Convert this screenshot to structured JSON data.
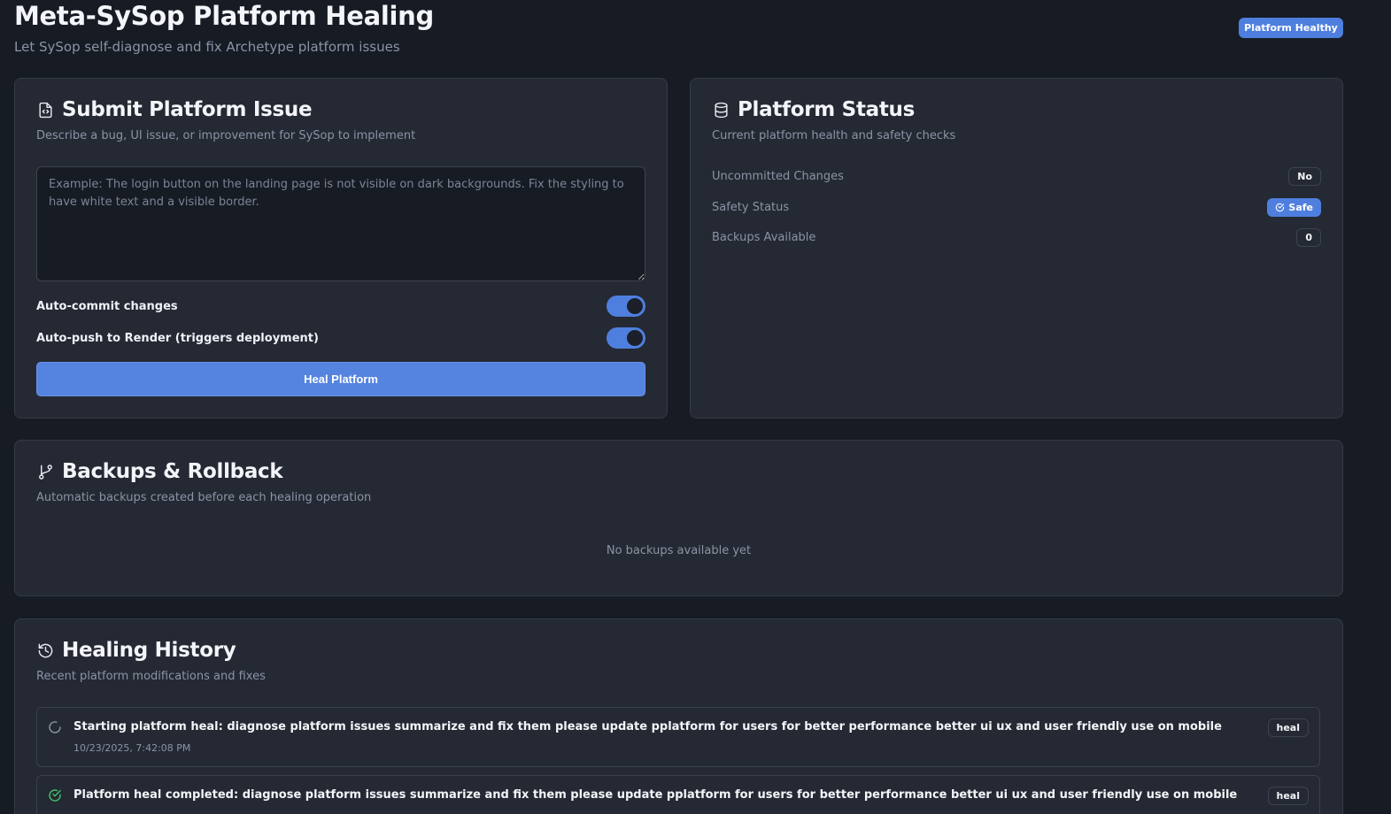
{
  "header": {
    "title": "Meta-SySop Platform Healing",
    "subtitle": "Let SySop self-diagnose and fix Archetype platform issues",
    "health_badge": "Platform Healthy"
  },
  "submit_card": {
    "title": "Submit Platform Issue",
    "description": "Describe a bug, UI issue, or improvement for SySop to implement",
    "textarea_placeholder": "Example: The login button on the landing page is not visible on dark backgrounds. Fix the styling to have white text and a visible border.",
    "textarea_value": "",
    "auto_commit_label": "Auto-commit changes",
    "auto_commit_on": true,
    "auto_push_label": "Auto-push to Render (triggers deployment)",
    "auto_push_on": true,
    "heal_button": "Heal Platform"
  },
  "status_card": {
    "title": "Platform Status",
    "description": "Current platform health and safety checks",
    "rows": [
      {
        "label": "Uncommitted Changes",
        "value": "No"
      },
      {
        "label": "Safety Status",
        "value": "Safe"
      },
      {
        "label": "Backups Available",
        "value": "0"
      }
    ]
  },
  "backups_card": {
    "title": "Backups & Rollback",
    "description": "Automatic backups created before each healing operation",
    "empty_text": "No backups available yet"
  },
  "history_card": {
    "title": "Healing History",
    "description": "Recent platform modifications and fixes",
    "items": [
      {
        "status": "loading",
        "text": "Starting platform heal: diagnose platform issues summarize and fix them please update pplatform for users for better performance better ui ux and user friendly use on mobile",
        "timestamp": "10/23/2025, 7:42:08 PM",
        "tag": "heal"
      },
      {
        "status": "completed",
        "text": "Platform heal completed: diagnose platform issues summarize and fix them please update pplatform for users for better performance better ui ux and user friendly use on mobile",
        "timestamp": "",
        "tag": "heal"
      }
    ]
  },
  "colors": {
    "background": "#171b24",
    "card": "#242933",
    "accent": "#4f7fde",
    "success": "#3fbf6a"
  }
}
